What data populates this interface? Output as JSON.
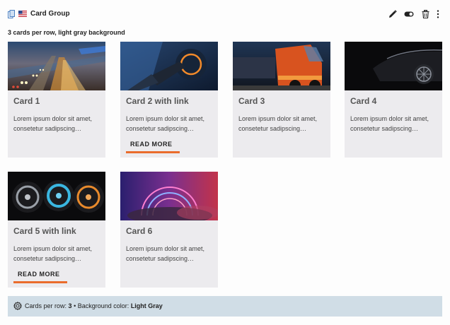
{
  "header": {
    "title": "Card Group",
    "subtitle": "3 cards per row, light gray background",
    "tools": [
      "edit-icon",
      "toggle-icon",
      "trash-icon",
      "more-vertical-icon"
    ]
  },
  "cards": [
    {
      "title": "Card 1",
      "text": "Lorem ipsum dolor sit amet, consetetur sadipscing…",
      "link": "",
      "image": "highway-traffic-photo"
    },
    {
      "title": "Card 2 with link",
      "text": "Lorem ipsum dolor sit amet, consetetur sadipscing…",
      "link": "READ MORE",
      "image": "ev-charging-photo"
    },
    {
      "title": "Card 3",
      "text": "Lorem ipsum dolor sit amet, consetetur sadipscing…",
      "link": "",
      "image": "truck-photo"
    },
    {
      "title": "Card 4",
      "text": "Lorem ipsum dolor sit amet, consetetur sadipscing…",
      "link": "",
      "image": "dark-car-photo"
    },
    {
      "title": "Card 5 with link",
      "text": "Lorem ipsum dolor sit amet, consetetur sadipscing…",
      "link": "READ MORE",
      "image": "wheel-rims-photo"
    },
    {
      "title": "Card 6",
      "text": "Lorem ipsum dolor sit amet, consetetur sadipscing…",
      "link": "",
      "image": "neon-rings-photo"
    }
  ],
  "footer": {
    "cards_label": "Cards per row:",
    "cards_value": "3",
    "separator": "•",
    "bg_label": "Background color:",
    "bg_value": "Light Gray"
  },
  "colors": {
    "card_bg": "#ecebee",
    "link_underline": "#ea6c2c",
    "footer_bg": "#d0dde6"
  }
}
